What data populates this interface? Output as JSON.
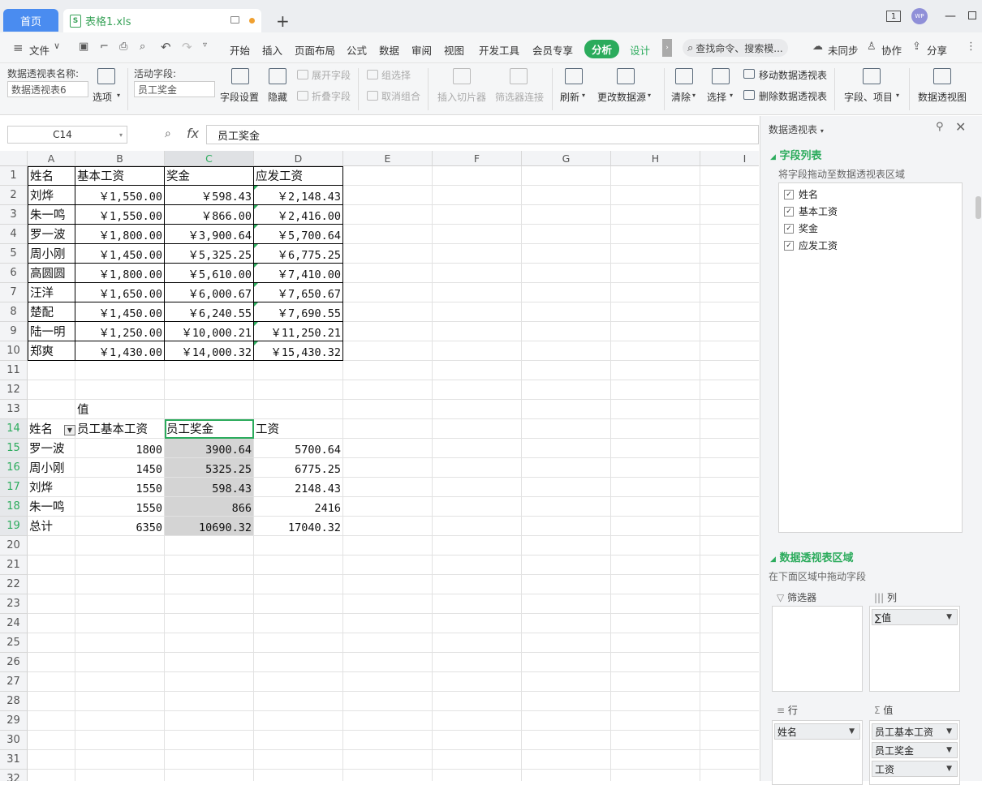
{
  "tabs": {
    "home": "首页",
    "file": "表格1.xls"
  },
  "titlebar": {
    "window_count": "1",
    "avatar_text": "WP"
  },
  "menu": {
    "file": "文件",
    "items": [
      "开始",
      "插入",
      "页面布局",
      "公式",
      "数据",
      "审阅",
      "视图",
      "开发工具",
      "会员专享"
    ],
    "active": "分析",
    "design": "设计",
    "search_placeholder": "查找命令、搜索模...",
    "sync": "未同步",
    "collab": "协作",
    "share": "分享"
  },
  "ribbon": {
    "pt_name_label": "数据透视表名称:",
    "pt_name_value": "数据透视表6",
    "options": "选项",
    "active_field_label": "活动字段:",
    "active_field_value": "员工奖金",
    "field_settings": "字段设置",
    "hide": "隐藏",
    "expand_field": "展开字段",
    "collapse_field": "折叠字段",
    "group_selection": "组选择",
    "ungroup": "取消组合",
    "insert_slicer": "插入切片器",
    "filter_connections": "筛选器连接",
    "refresh": "刷新",
    "change_source": "更改数据源",
    "clear": "清除",
    "select": "选择",
    "move_pt": "移动数据透视表",
    "delete_pt": "删除数据透视表",
    "fields_items": "字段、项目",
    "pivot_chart": "数据透视图"
  },
  "formula_bar": {
    "cell_ref": "C14",
    "fx": "fx",
    "formula": "员工奖金"
  },
  "sheet": {
    "columns": [
      "A",
      "B",
      "C",
      "D",
      "E",
      "F",
      "G",
      "H",
      "I"
    ],
    "selected_column": "C",
    "rows": [
      "1",
      "2",
      "3",
      "4",
      "5",
      "6",
      "7",
      "8",
      "9",
      "10",
      "11",
      "12",
      "13",
      "14",
      "15",
      "16",
      "17",
      "18",
      "19",
      "20",
      "21",
      "22",
      "23",
      "24",
      "25",
      "26",
      "27",
      "28",
      "29",
      "30",
      "31",
      "32"
    ],
    "selected_rows": [
      "14",
      "15",
      "16",
      "17",
      "18",
      "19"
    ],
    "table_header": [
      "姓名",
      "基本工资",
      "奖金",
      "应发工资"
    ],
    "table_rows": [
      [
        "刘烨",
        "￥1,550.00",
        "￥598.43",
        "￥2,148.43"
      ],
      [
        "朱一鸣",
        "￥1,550.00",
        "￥866.00",
        "￥2,416.00"
      ],
      [
        "罗一波",
        "￥1,800.00",
        "￥3,900.64",
        "￥5,700.64"
      ],
      [
        "周小刚",
        "￥1,450.00",
        "￥5,325.25",
        "￥6,775.25"
      ],
      [
        "高圆圆",
        "￥1,800.00",
        "￥5,610.00",
        "￥7,410.00"
      ],
      [
        "汪洋",
        "￥1,650.00",
        "￥6,000.67",
        "￥7,650.67"
      ],
      [
        "楚配",
        "￥1,450.00",
        "￥6,240.55",
        "￥7,690.55"
      ],
      [
        "陆一明",
        "￥1,250.00",
        "￥10,000.21",
        "￥11,250.21"
      ],
      [
        "郑爽",
        "￥1,430.00",
        "￥14,000.32",
        "￥15,430.32"
      ]
    ],
    "pivot_values_label": "值",
    "pivot_header": [
      "姓名",
      "员工基本工资",
      "员工奖金",
      "工资"
    ],
    "pivot_rows": [
      [
        "罗一波",
        "1800",
        "3900.64",
        "5700.64"
      ],
      [
        "周小刚",
        "1450",
        "5325.25",
        "6775.25"
      ],
      [
        "刘烨",
        "1550",
        "598.43",
        "2148.43"
      ],
      [
        "朱一鸣",
        "1550",
        "866",
        "2416"
      ]
    ],
    "pivot_total": [
      "总计",
      "6350",
      "10690.32",
      "17040.32"
    ]
  },
  "panel": {
    "title": "数据透视表",
    "field_list_title": "字段列表",
    "field_list_desc": "将字段拖动至数据透视表区域",
    "fields": [
      "姓名",
      "基本工资",
      "奖金",
      "应发工资"
    ],
    "area_title": "数据透视表区域",
    "area_desc": "在下面区域中拖动字段",
    "filter_label": "筛选器",
    "column_label": "列",
    "row_label": "行",
    "value_label": "值",
    "column_items": [
      "∑值"
    ],
    "row_items": [
      "姓名"
    ],
    "value_items": [
      "员工基本工资",
      "员工奖金",
      "工资"
    ]
  },
  "icons": [
    "file-icon",
    "monitor-icon",
    "plus-icon",
    "menu-icon",
    "save-icon",
    "undo-icon",
    "redo-icon",
    "search-icon",
    "cloud-icon",
    "user-icon",
    "share-icon",
    "pin-icon",
    "close-icon",
    "checkbox-icon",
    "filter-icon"
  ],
  "colors": {
    "accent_green": "#2bab5c",
    "tab_blue": "#4a8cf0",
    "selection_fill": "#d4d4d4"
  }
}
